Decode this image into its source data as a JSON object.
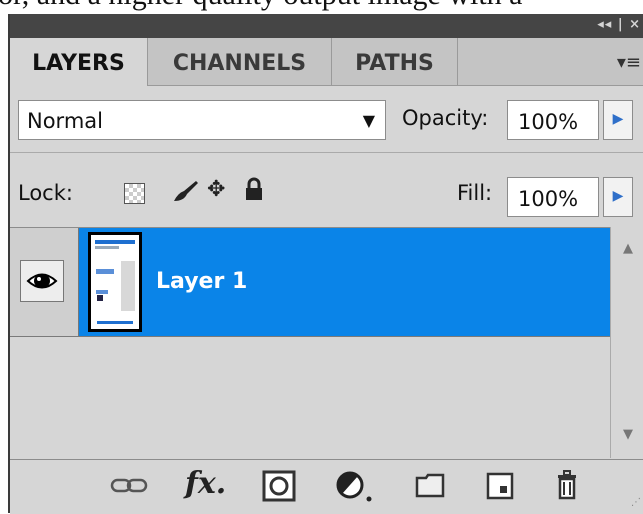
{
  "top_cutoff_text": "or, and a higher quality output image with a",
  "titlebar": {
    "controls": "◂◂ | ×"
  },
  "tabs": [
    {
      "label": "LAYERS",
      "active": true
    },
    {
      "label": "CHANNELS",
      "active": false
    },
    {
      "label": "PATHS",
      "active": false
    }
  ],
  "panel_menu_icon": "▾≡",
  "blend_mode": {
    "value": "Normal"
  },
  "opacity": {
    "label": "Opacity:",
    "value": "100%"
  },
  "lock": {
    "label": "Lock:"
  },
  "fill": {
    "label": "Fill:",
    "value": "100%"
  },
  "layers": [
    {
      "name": "Layer 1",
      "visible": true,
      "selected": true
    }
  ],
  "colors": {
    "selection": "#0a84e8",
    "panel_bg": "#d6d6d6",
    "titlebar": "#454545",
    "stepper_arrow": "#2f6fc9"
  },
  "bottom_icons": [
    "link-layers-icon",
    "fx-icon",
    "layer-mask-icon",
    "adjustment-layer-icon",
    "group-folder-icon",
    "new-layer-icon",
    "trash-icon"
  ]
}
